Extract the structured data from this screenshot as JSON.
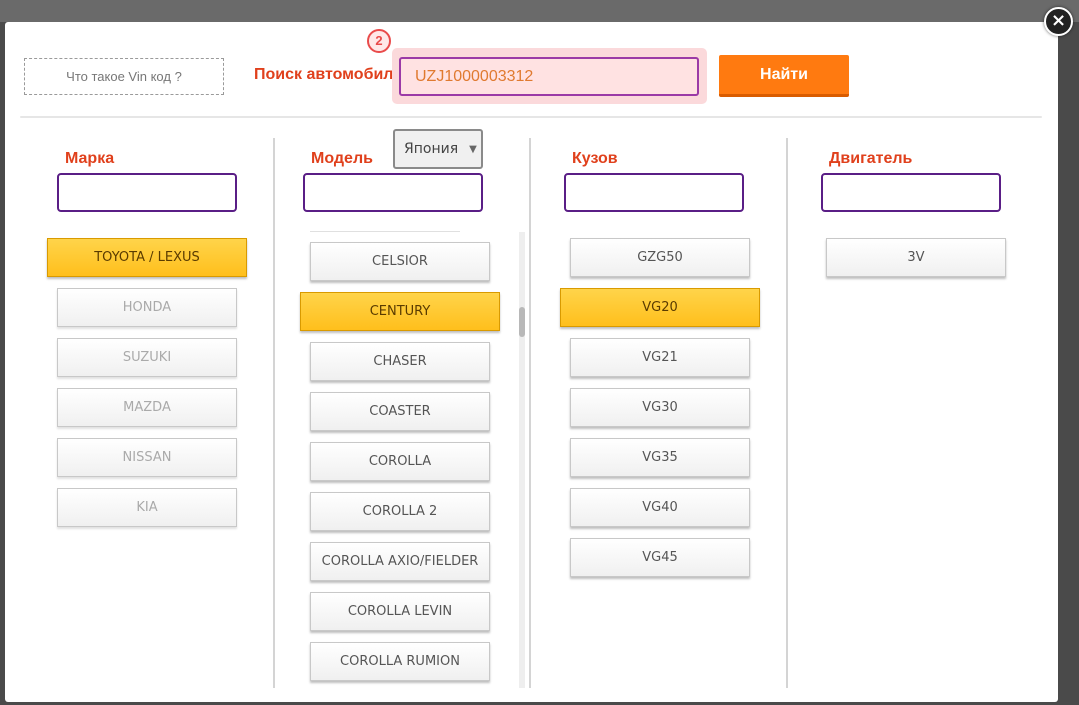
{
  "close_icon": "×",
  "vin_help": "Что такое Vin код ?",
  "search": {
    "label": "Поиск автомобиля",
    "step": "2",
    "value": "UZJ1000003312",
    "button": "Найти"
  },
  "columns": {
    "brand": {
      "title": "Марка",
      "items": [
        {
          "label": "TOYOTA / LEXUS",
          "state": "selected"
        },
        {
          "label": "HONDA",
          "state": "disabled"
        },
        {
          "label": "SUZUKI",
          "state": "disabled"
        },
        {
          "label": "MAZDA",
          "state": "disabled"
        },
        {
          "label": "NISSAN",
          "state": "disabled"
        },
        {
          "label": "KIA",
          "state": "disabled"
        }
      ]
    },
    "model": {
      "title": "Модель",
      "country": "Япония",
      "items": [
        {
          "label": "CELSIOR",
          "state": "normal"
        },
        {
          "label": "CENTURY",
          "state": "selected"
        },
        {
          "label": "CHASER",
          "state": "normal"
        },
        {
          "label": "COASTER",
          "state": "normal"
        },
        {
          "label": "COROLLA",
          "state": "normal"
        },
        {
          "label": "COROLLA 2",
          "state": "normal"
        },
        {
          "label": "COROLLA AXIO/FIELDER",
          "state": "normal"
        },
        {
          "label": "COROLLA LEVIN",
          "state": "normal"
        },
        {
          "label": "COROLLA RUMION",
          "state": "normal"
        }
      ]
    },
    "body": {
      "title": "Кузов",
      "items": [
        {
          "label": "GZG50",
          "state": "normal"
        },
        {
          "label": "VG20",
          "state": "selected"
        },
        {
          "label": "VG21",
          "state": "normal"
        },
        {
          "label": "VG30",
          "state": "normal"
        },
        {
          "label": "VG35",
          "state": "normal"
        },
        {
          "label": "VG40",
          "state": "normal"
        },
        {
          "label": "VG45",
          "state": "normal"
        }
      ]
    },
    "engine": {
      "title": "Двигатель",
      "items": [
        {
          "label": "3V",
          "state": "normal"
        }
      ]
    }
  },
  "colors": {
    "accent_red": "#e0401c",
    "button_orange": "#ff7a10",
    "selected_yellow": "#ffc72c",
    "filter_border": "#5a1e86"
  }
}
